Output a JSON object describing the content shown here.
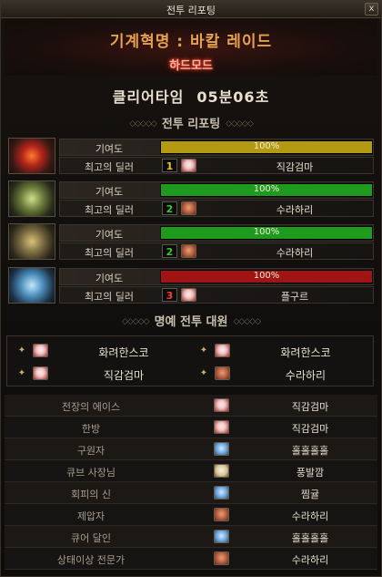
{
  "window": {
    "title": "전투 리포팅",
    "close_label": "x"
  },
  "header": {
    "raid_title": "기계혁명 : 바칼 레이드",
    "mode": "하드모드"
  },
  "clear": {
    "label": "클리어타임",
    "time": "05분06초"
  },
  "sections": {
    "report": "전투 리포팅",
    "honor": "명예 전투 대원"
  },
  "bosses": [
    {
      "contribution_label": "기여도",
      "contribution": "100%",
      "contribution_value": 100,
      "bar_color": "#b49a10",
      "dealer_label": "최고의 딜러",
      "rank": "1",
      "rank_color": "#e6c23a",
      "dealer": "직감검마",
      "avatar": "av-white",
      "portrait": "red"
    },
    {
      "contribution_label": "기여도",
      "contribution": "100%",
      "contribution_value": 100,
      "bar_color": "#1e9a1e",
      "dealer_label": "최고의 딜러",
      "rank": "2",
      "rank_color": "#33cc33",
      "dealer": "수라하리",
      "avatar": "av-brown",
      "portrait": "green"
    },
    {
      "contribution_label": "기여도",
      "contribution": "100%",
      "contribution_value": 100,
      "bar_color": "#1e9a1e",
      "dealer_label": "최고의 딜러",
      "rank": "2",
      "rank_color": "#33cc33",
      "dealer": "수라하리",
      "avatar": "av-brown",
      "portrait": "gold"
    },
    {
      "contribution_label": "기여도",
      "contribution": "100%",
      "contribution_value": 100,
      "bar_color": "#a01414",
      "dealer_label": "최고의 딜러",
      "rank": "3",
      "rank_color": "#ff3a3a",
      "dealer": "플구르",
      "avatar": "av-white",
      "portrait": "blue"
    }
  ],
  "honor": [
    {
      "name": "화려한스코",
      "avatar": "av-white"
    },
    {
      "name": "화려한스코",
      "avatar": "av-white"
    },
    {
      "name": "직감검마",
      "avatar": "av-white"
    },
    {
      "name": "수라하리",
      "avatar": "av-brown"
    }
  ],
  "awards": [
    {
      "label": "전장의 에이스",
      "player": "직감검마",
      "avatar": "av-white"
    },
    {
      "label": "한방",
      "player": "직감검마",
      "avatar": "av-white"
    },
    {
      "label": "구원자",
      "player": "홀홀홀홀",
      "avatar": "av-blue"
    },
    {
      "label": "큐브 사장님",
      "player": "풍발깜",
      "avatar": "av-gold"
    },
    {
      "label": "회피의 신",
      "player": "찜귤",
      "avatar": "av-blue"
    },
    {
      "label": "제압자",
      "player": "수라하리",
      "avatar": "av-brown"
    },
    {
      "label": "큐어 달인",
      "player": "홀홀홀홀",
      "avatar": "av-blue"
    },
    {
      "label": "상태이상 전문가",
      "player": "수라하리",
      "avatar": "av-brown"
    }
  ],
  "colors": {
    "accent": "#e5a14f",
    "hard_mode_glow": "#ff3a20"
  },
  "icons": {
    "medal": "medal-icon",
    "close": "close-icon"
  }
}
